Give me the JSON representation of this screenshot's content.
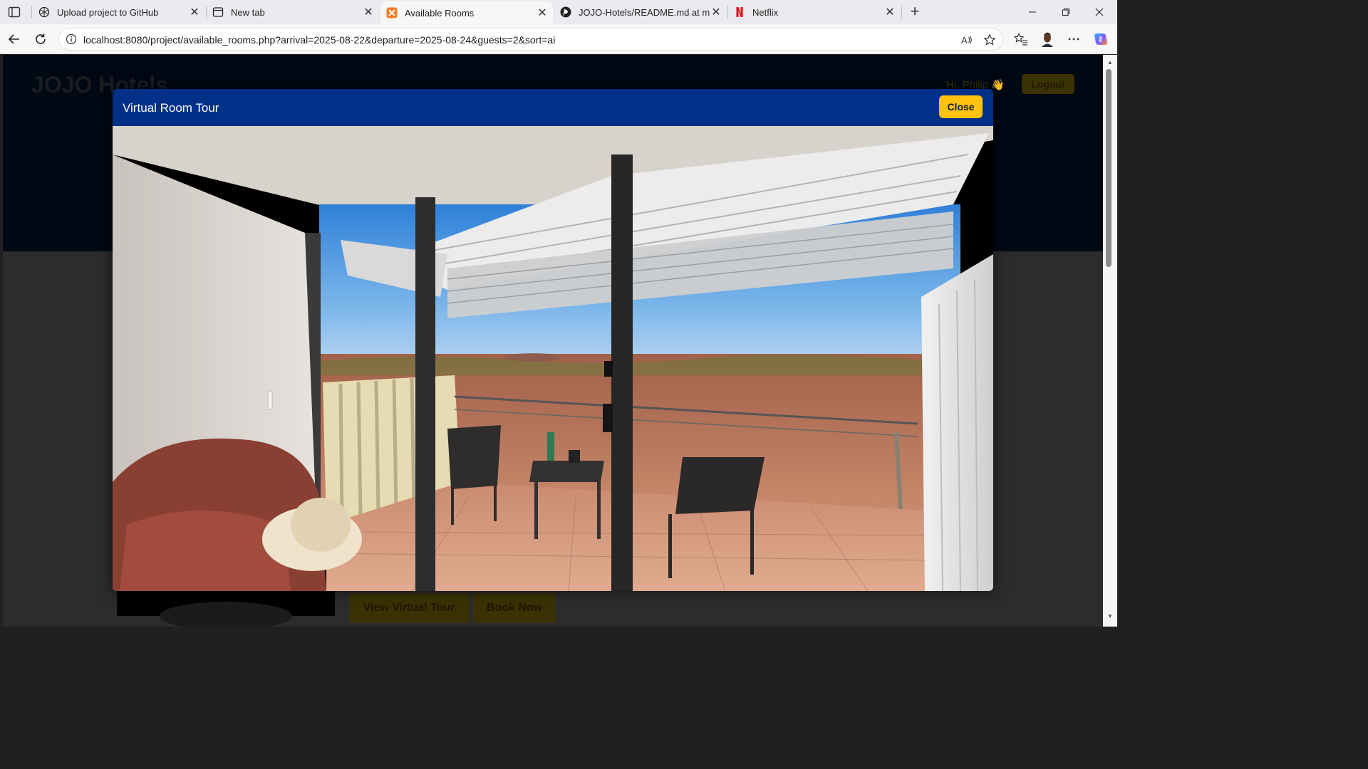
{
  "browser": {
    "tabs": [
      {
        "title": "Upload project to GitHub",
        "icon": "chatgpt-icon",
        "active": false
      },
      {
        "title": "New tab",
        "icon": "new-tab-page-icon",
        "active": false
      },
      {
        "title": "Available Rooms",
        "icon": "xampp-icon",
        "active": true
      },
      {
        "title": "JOJO-Hotels/README.md at main",
        "icon": "github-icon",
        "active": false
      },
      {
        "title": "Netflix",
        "icon": "netflix-icon",
        "active": false
      }
    ],
    "url": "localhost:8080/project/available_rooms.php?arrival=2025-08-22&departure=2025-08-24&guests=2&sort=ai"
  },
  "page": {
    "brand": "JOJO Hotels",
    "greeting": "Hi, Philip 👋",
    "logout_label": "Logout",
    "room_card": {
      "view_tour_label": "View Virtual Tour",
      "book_label": "Book Now"
    }
  },
  "modal": {
    "title": "Virtual Room Tour",
    "close_label": "Close"
  },
  "colors": {
    "modal_header": "#003087",
    "accent_yellow": "#ffc20e",
    "hero_bg": "#000814"
  }
}
